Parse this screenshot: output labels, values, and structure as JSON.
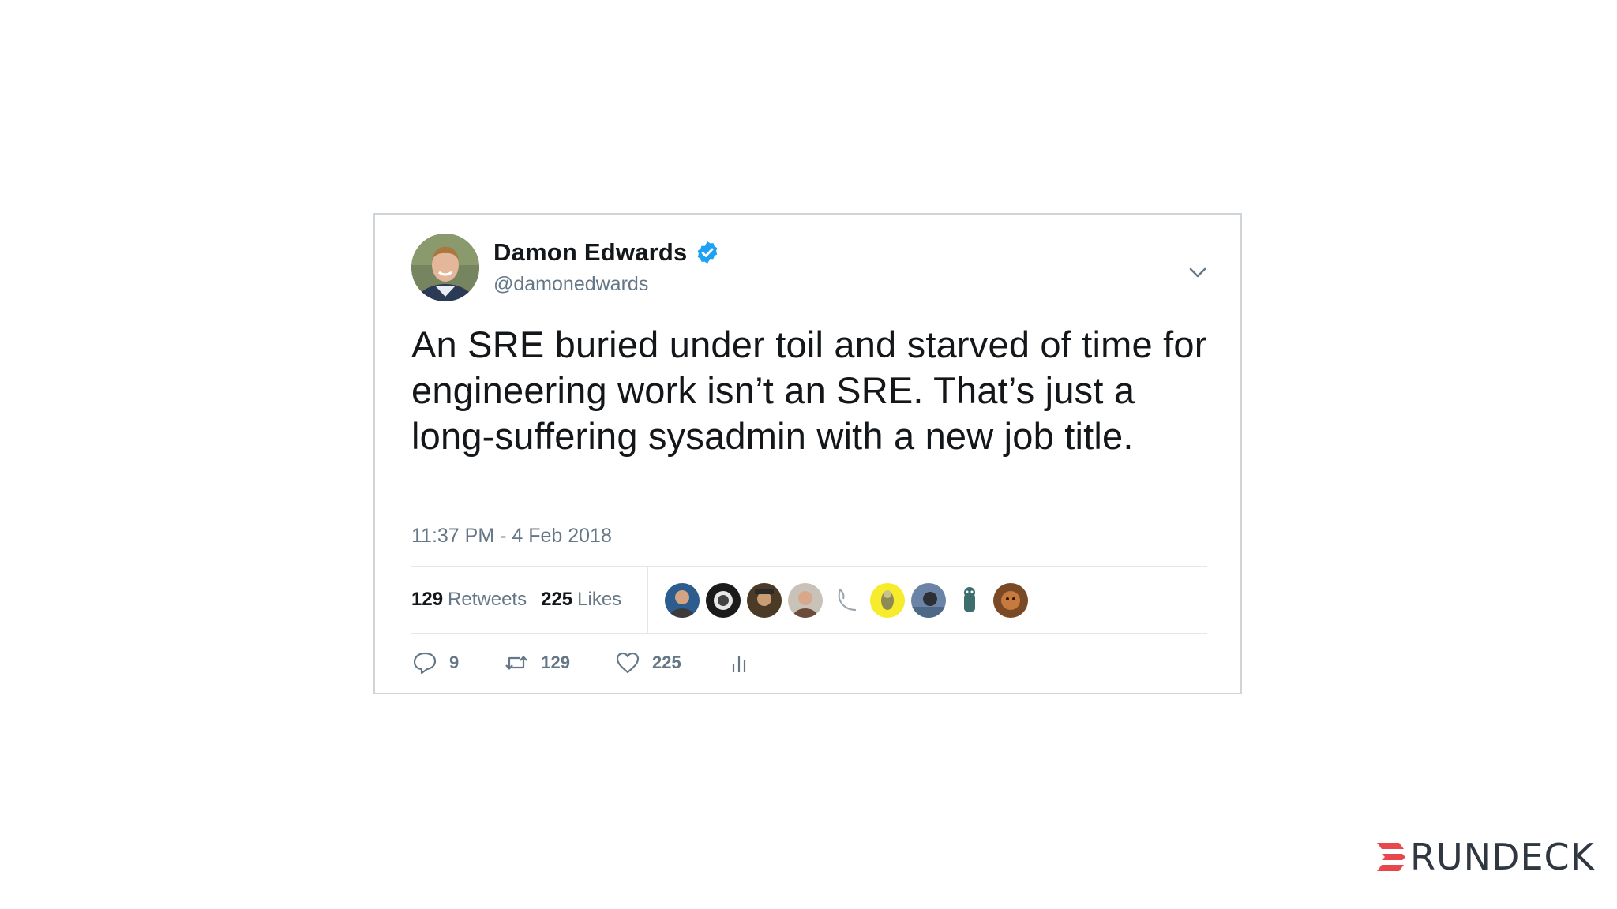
{
  "tweet": {
    "author": {
      "display_name": "Damon Edwards",
      "handle": "@damonedwards",
      "verified": true,
      "avatar_icon": "profile-photo"
    },
    "text": "An SRE buried under toil and starved of time for engineering work isn’t an SRE. That’s just a long-suffering sysadmin with a new job title.",
    "timestamp": "11:37 PM - 4 Feb 2018",
    "stats": {
      "retweets_count": "129",
      "retweets_label": "Retweets",
      "likes_count": "225",
      "likes_label": "Likes"
    },
    "likers_count_shown": 9,
    "actions": {
      "reply_count": "9",
      "retweet_count": "129",
      "like_count": "225"
    },
    "menu_icon": "chevron-down-icon"
  },
  "brand": {
    "name": "RUNDECK",
    "accent_color": "#e8474b"
  },
  "colors": {
    "verified_badge": "#1da1f2",
    "secondary_text": "#657786",
    "primary_text": "#14171a",
    "border": "#cfd4d9"
  }
}
